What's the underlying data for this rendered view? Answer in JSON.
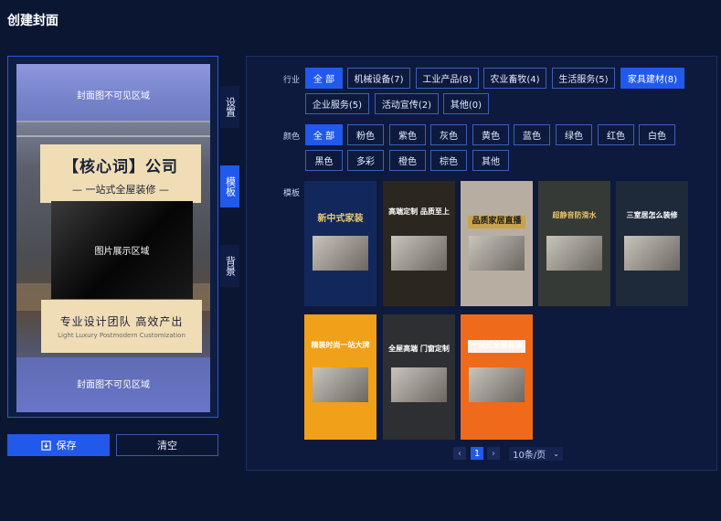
{
  "page_title": "创建封面",
  "preview": {
    "mask_top": "封面图不可见区域",
    "mask_bottom": "封面图不可见区域",
    "keyword_title": "【核心词】公司",
    "keyword_sub": "— 一站式全屋装修 —",
    "image_area": "图片展示区域",
    "slogan": "专业设计团队 高效产出",
    "slogan_en": "Light Luxury Postmodern Customization"
  },
  "side_tabs": [
    {
      "label": "设置"
    },
    {
      "label": "模板"
    },
    {
      "label": "背景"
    }
  ],
  "actions": {
    "save": "保存",
    "clear": "清空"
  },
  "filters": {
    "industry_label": "行业",
    "industry": [
      "全 部",
      "机械设备(7)",
      "工业产品(8)",
      "农业畜牧(4)",
      "生活服务(5)",
      "家具建材(8)",
      "企业服务(5)",
      "活动宣传(2)",
      "其他(0)"
    ],
    "color_label": "颜色",
    "colors": [
      "全 部",
      "粉色",
      "紫色",
      "灰色",
      "黄色",
      "蓝色",
      "绿色",
      "红色",
      "白色",
      "黑色",
      "多彩",
      "橙色",
      "棕色",
      "其他"
    ],
    "template_label": "模板"
  },
  "templates": [
    {
      "caption": "新中式家装",
      "bg": "#12285c",
      "fg": "#e7c872"
    },
    {
      "caption": "高端定制 品质至上",
      "bg": "#2c2620",
      "fg": "#ffffff"
    },
    {
      "caption": "品质家居直播",
      "bg": "#b7aea1",
      "fg": "#1b1b1b"
    },
    {
      "caption": "超静音防滑水",
      "bg": "#363a36",
      "fg": "#e8c16a"
    },
    {
      "caption": "三室居怎么装修",
      "bg": "#1e2a3a",
      "fg": "#ffffff"
    },
    {
      "caption": "精装时尚一站大牌",
      "bg": "#f0a019",
      "fg": "#ffffff"
    },
    {
      "caption": "全屋高端 门窗定制",
      "bg": "#2d2f33",
      "fg": "#ffffff"
    },
    {
      "caption": "一站式全屋装修",
      "bg": "#ef6a1a",
      "fg": "#ffffff"
    }
  ],
  "pagination": {
    "prev": "‹",
    "page": "1",
    "next": "›",
    "page_size": "10条/页"
  }
}
